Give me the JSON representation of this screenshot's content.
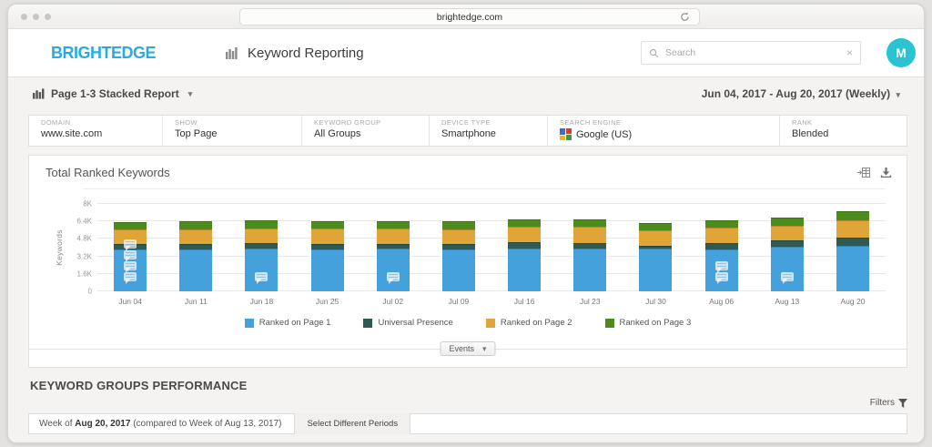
{
  "browser": {
    "url": "brightedge.com"
  },
  "header": {
    "logo": "BRIGHTEDGE",
    "logo_color": "#29abe2",
    "title": "Keyword Reporting",
    "search_placeholder": "Search",
    "avatar_initial": "M",
    "avatar_color": "#2bc3d2"
  },
  "toolbar": {
    "report_selector": "Page 1-3 Stacked Report",
    "date_range": "Jun 04, 2017 - Aug 20, 2017 (Weekly)"
  },
  "filters": [
    {
      "label": "DOMAIN",
      "value": "www.site.com"
    },
    {
      "label": "SHOW",
      "value": "Top Page"
    },
    {
      "label": "KEYWORD GROUP",
      "value": "All Groups"
    },
    {
      "label": "DEVICE TYPE",
      "value": "Smartphone"
    },
    {
      "label": "SEARCH ENGINE",
      "value": "Google (US)",
      "icon": "google"
    },
    {
      "label": "RANK",
      "value": "Blended"
    }
  ],
  "chart_panel": {
    "title": "Total Ranked Keywords"
  },
  "chart_data": {
    "type": "bar",
    "stacked": true,
    "title": "Total Ranked Keywords",
    "ylabel": "Keywords",
    "ylim": [
      0,
      8000
    ],
    "yticks": [
      "0",
      "1.6K",
      "3.2K",
      "4.8K",
      "6.4K",
      "8K"
    ],
    "grid": true,
    "legend_position": "bottom",
    "categories": [
      "Jun 04",
      "Jun 11",
      "Jun 18",
      "Jun 25",
      "Jul 02",
      "Jul 09",
      "Jul 16",
      "Jul 23",
      "Jul 30",
      "Aug 06",
      "Aug 13",
      "Aug 20"
    ],
    "series": [
      {
        "name": "Ranked on Page 1",
        "color": "#45a1dc",
        "values": [
          3800,
          3850,
          3900,
          3850,
          3900,
          3850,
          3950,
          3950,
          3900,
          3850,
          4100,
          4150
        ]
      },
      {
        "name": "Universal Presence",
        "color": "#2d5a53",
        "values": [
          500,
          480,
          500,
          480,
          450,
          450,
          550,
          500,
          300,
          600,
          550,
          800
        ]
      },
      {
        "name": "Ranked on Page 2",
        "color": "#e0a437",
        "values": [
          1400,
          1370,
          1350,
          1420,
          1400,
          1400,
          1400,
          1450,
          1400,
          1350,
          1350,
          1550
        ]
      },
      {
        "name": "Ranked on Page 3",
        "color": "#4c8c1d",
        "values": [
          650,
          700,
          750,
          650,
          700,
          700,
          700,
          700,
          650,
          700,
          750,
          800
        ]
      }
    ],
    "event_markers_per_category": [
      4,
      0,
      1,
      0,
      1,
      0,
      0,
      0,
      0,
      2,
      1,
      0
    ]
  },
  "events_button": {
    "label": "Events"
  },
  "section": {
    "title": "KEYWORD GROUPS PERFORMANCE",
    "filters_label": "Filters"
  },
  "week_row": {
    "prefix": "Week of ",
    "bold": "Aug 20, 2017",
    "suffix": " (compared to Week of Aug 13, 2017)",
    "button": "Select Different Periods"
  }
}
